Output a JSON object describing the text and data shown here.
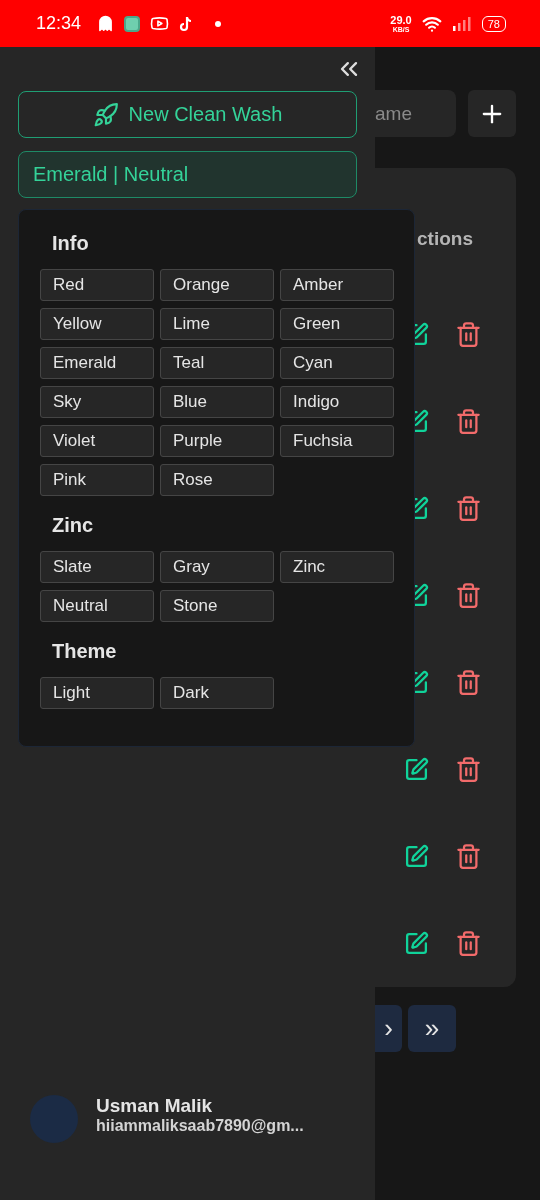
{
  "status_bar": {
    "time": "12:34",
    "speed": "29.0",
    "speed_unit": "KB/S",
    "battery": "78"
  },
  "sidebar": {
    "new_button": "New Clean Wash",
    "theme_selector": "Emerald | Neutral",
    "theme_menu": [
      {
        "title": "Info",
        "options": [
          "Red",
          "Orange",
          "Amber",
          "Yellow",
          "Lime",
          "Green",
          "Emerald",
          "Teal",
          "Cyan",
          "Sky",
          "Blue",
          "Indigo",
          "Violet",
          "Purple",
          "Fuchsia",
          "Pink",
          "Rose"
        ]
      },
      {
        "title": "Zinc",
        "options": [
          "Slate",
          "Gray",
          "Zinc",
          "Neutral",
          "Stone"
        ]
      },
      {
        "title": "Theme",
        "options": [
          "Light",
          "Dark"
        ]
      }
    ],
    "user": {
      "name": "Usman Malik",
      "email": "hiiammaliksaab7890@gm..."
    }
  },
  "main": {
    "search": {
      "placeholder": "ame"
    },
    "table": {
      "column_header": "ctions",
      "rows": [
        {
          "kind": "actions"
        },
        {
          "kind": "actions"
        },
        {
          "kind": "actions"
        },
        {
          "kind": "actions"
        },
        {
          "kind": "actions"
        },
        {
          "kind": "actions"
        },
        {
          "kind": "actions"
        },
        {
          "kind": "actions"
        }
      ]
    },
    "pagination": [
      {
        "label": "›"
      },
      {
        "label": "»"
      }
    ]
  }
}
